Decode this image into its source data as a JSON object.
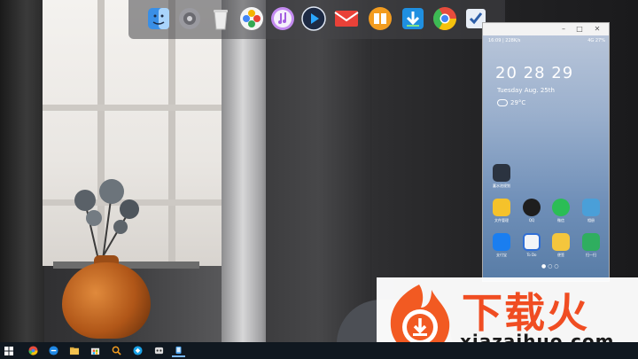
{
  "dock": {
    "items": [
      {
        "name": "finder-icon",
        "color": "#3a8fe6"
      },
      {
        "name": "system-preferences-icon",
        "color": "#8e8e93"
      },
      {
        "name": "trash-icon",
        "color": "#e6e6e6"
      },
      {
        "name": "photos-icon",
        "color": "#f2f2f2"
      },
      {
        "name": "itunes-icon",
        "color": "#b06ee8"
      },
      {
        "name": "video-player-icon",
        "color": "#1d2a44"
      },
      {
        "name": "mail-icon",
        "color": "#d9302c"
      },
      {
        "name": "books-icon",
        "color": "#f29b20"
      },
      {
        "name": "download-icon",
        "color": "#1f8fe0"
      },
      {
        "name": "chrome-icon",
        "color": "#e74c3c"
      },
      {
        "name": "notes-checklist-icon",
        "color": "#2d5ea8"
      }
    ]
  },
  "phone": {
    "status_left": "16:09 | 228K/s",
    "status_right": "4G  27%",
    "time": "20 28 29",
    "date": "Tuesday  Aug. 25th",
    "temperature": "29°C",
    "apps_row1": [
      {
        "label": "蓄水池规划",
        "color": "#2b3340"
      }
    ],
    "apps_row2": [
      {
        "label": "文件管理",
        "color": "#f5c22b"
      },
      {
        "label": "QQ",
        "color": "#1e1e1e"
      },
      {
        "label": "微信",
        "color": "#2bbd55"
      },
      {
        "label": "相册",
        "color": "#4a9fd8"
      }
    ],
    "apps_row3": [
      {
        "label": "支付宝",
        "color": "#1a7ef0"
      },
      {
        "label": "To Do",
        "color": "#2f6ed6"
      },
      {
        "label": "便签",
        "color": "#f4c63d"
      },
      {
        "label": "扫一扫",
        "color": "#2fae5f"
      }
    ],
    "page_dots": "● ○ ○"
  },
  "watermark": {
    "text": "下载火",
    "url": "xiazaihuo.com"
  },
  "taskbar": {
    "items": [
      {
        "name": "start-button-icon"
      },
      {
        "name": "chrome-taskbar-icon"
      },
      {
        "name": "edge-taskbar-icon"
      },
      {
        "name": "file-explorer-taskbar-icon"
      },
      {
        "name": "store-taskbar-icon"
      },
      {
        "name": "search-app-taskbar-icon"
      },
      {
        "name": "network-app-taskbar-icon"
      },
      {
        "name": "game-taskbar-icon"
      },
      {
        "name": "phone-mirror-taskbar-icon"
      }
    ]
  }
}
